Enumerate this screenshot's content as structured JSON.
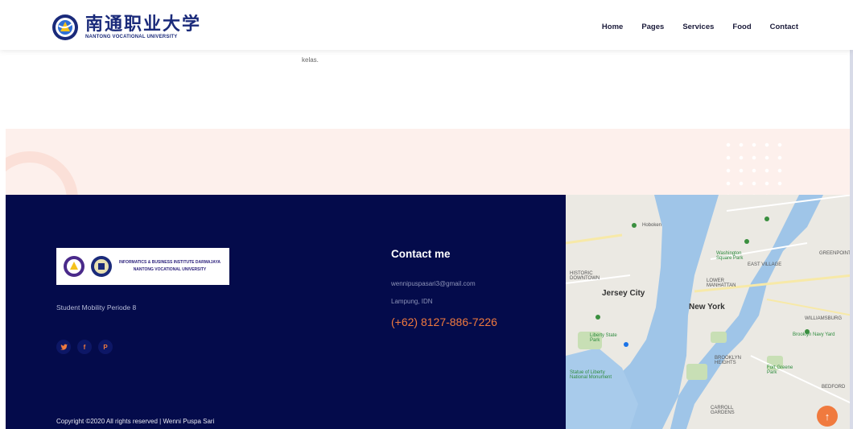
{
  "header": {
    "logo_cn": "南通职业大学",
    "logo_en": "NANTONG VOCATIONAL UNIVERSITY",
    "nav": [
      "Home",
      "Pages",
      "Services",
      "Food",
      "Contact"
    ]
  },
  "content": {
    "text_fragment": "kelas."
  },
  "footer": {
    "logo": {
      "line1": "INFORMATICS & BUSINESS INSTITUTE DARMAJAYA",
      "line2": "NANTONG VOCATIONAL UNIVERSITY"
    },
    "tagline": "Student Mobility Periode 8",
    "socials": [
      {
        "icon": "twitter-icon",
        "glyph": "🐦"
      },
      {
        "icon": "facebook-icon",
        "glyph": "f"
      },
      {
        "icon": "pinterest-icon",
        "glyph": "P"
      }
    ],
    "copyright": "Copyright ©2020 All rights reserved | Wenni Puspa Sari"
  },
  "contact": {
    "title": "Contact me",
    "email": "wennipuspasari3@gmail.com",
    "location": "Lampung, IDN",
    "phone": "(+62) 8127-886-7226"
  },
  "map": {
    "labels": {
      "hoboken": "Hoboken",
      "jersey_city": "Jersey City",
      "new_york": "New York",
      "historic_downtown": "HISTORIC DOWNTOWN",
      "washington_sq": "Washington Square Park",
      "east_village": "EAST VILLAGE",
      "lower_manhattan": "LOWER MANHATTAN",
      "brooklyn_heights": "BROOKLYN HEIGHTS",
      "williamsburg": "WILLIAMSBURG",
      "greenpoint": "GREENPOINT",
      "liberty_state_park": "Liberty State Park",
      "statue_of_liberty": "Statue of Liberty National Monument",
      "fort_greene": "Fort Greene Park",
      "bedford": "BEDFORD",
      "carroll_gardens": "CARROLL GARDENS",
      "brooklyn_navy_yard": "Brooklyn Navy Yard"
    }
  },
  "colors": {
    "footer_bg": "#040b4b",
    "accent": "#f07a3e",
    "band_bg": "#fdf0ec"
  }
}
